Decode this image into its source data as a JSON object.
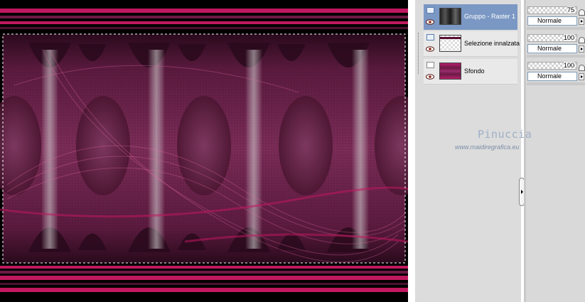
{
  "layers": [
    {
      "name": "Gruppo - Raster 1",
      "thumb": "group-thumbnail",
      "selected": true,
      "visibility_icon": "layer-group-icon"
    },
    {
      "name": "Selezione innalzata",
      "thumb": "selection-thumbnail",
      "selected": false,
      "visibility_icon": "raster-layer-icon"
    },
    {
      "name": "Sfondo",
      "thumb": "background-thumbnail",
      "selected": false,
      "visibility_icon": "background-layer-icon"
    }
  ],
  "properties": [
    {
      "opacity": "75",
      "blend_mode": "Normale"
    },
    {
      "opacity": "100",
      "blend_mode": "Normale"
    },
    {
      "opacity": "100",
      "blend_mode": "Normale"
    }
  ],
  "watermark": {
    "title": "Pinuccia",
    "url": "www.maidiregrafica.eu"
  },
  "colors": {
    "accent_magenta": "#c0185f",
    "deep_plum": "#4a1230",
    "selected_row": "#7b98c4",
    "panel_bg": "#dcdcdc"
  }
}
